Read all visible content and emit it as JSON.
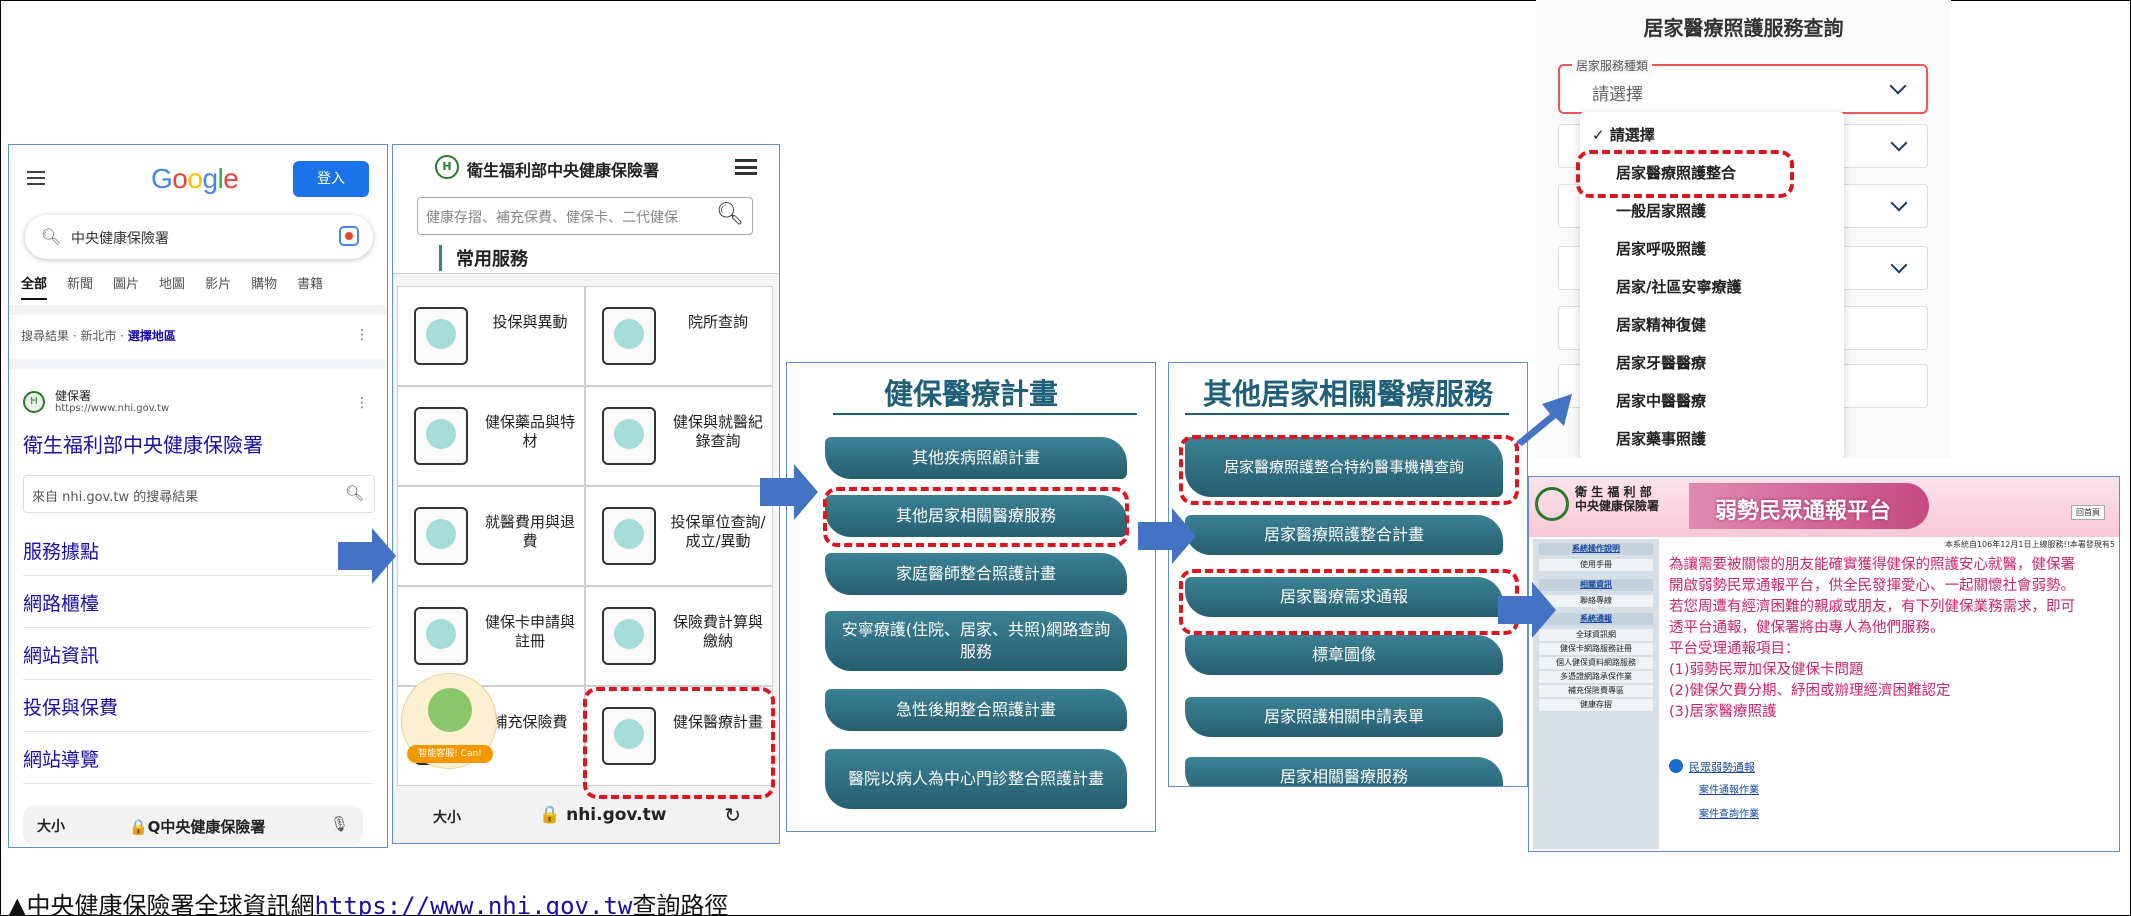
{
  "google": {
    "logo": [
      "G",
      "o",
      "o",
      "g",
      "l",
      "e"
    ],
    "login": "登入",
    "query": "中央健康保險署",
    "tabs": [
      "全部",
      "新聞",
      "圖片",
      "地圖",
      "影片",
      "購物",
      "書籍"
    ],
    "location_prefix": "搜尋結果 · 新北市 · ",
    "location_link": "選擇地區",
    "result_site_name": "健保署",
    "result_url": "https://www.nhi.gov.tw",
    "result_title": "衛生福利部中央健康保險署",
    "site_search_placeholder": "來自 nhi.gov.tw 的搜尋結果",
    "sitelinks": [
      "服務據點",
      "網路櫃檯",
      "網站資訊",
      "投保與保費",
      "網站導覽"
    ],
    "bottom_size": "大小",
    "bottom_url": "🔒Q中央健康保險署"
  },
  "nhi_mobile": {
    "logo_glyph": "H",
    "org_name": "衛生福利部中央健康保險署",
    "search_placeholder": "健康存摺、補充保費、健保卡、二代健保",
    "section_title": "常用服務",
    "services": [
      "投保與異動",
      "院所查詢",
      "健保藥品與特材",
      "健保與就醫紀錄查詢",
      "就醫費用與退費",
      "投保單位查詢/成立/異動",
      "健保卡申請與註冊",
      "保險費計算與繳納",
      "補充保險費",
      "健保醫療計畫"
    ],
    "mascot_badge": "智能客服! Can!",
    "bottom_size": "大小",
    "bottom_url": "🔒 nhi.gov.tw",
    "reload": "↻"
  },
  "plan_panel": {
    "title": "健保醫療計畫",
    "items": [
      "其他疾病照顧計畫",
      "其他居家相關醫療服務",
      "家庭醫師整合照護計畫",
      "安寧療護(住院、居家、共照)網路查詢服務",
      "急性後期整合照護計畫",
      "醫院以病人為中心門診整合照護計畫"
    ]
  },
  "home_panel": {
    "title": "其他居家相關醫療服務",
    "items": [
      "居家醫療照護整合特約醫事機構查詢",
      "居家醫療照護整合計畫",
      "居家醫療需求通報",
      "標章圖像",
      "居家照護相關申請表單",
      "居家相關醫療服務"
    ]
  },
  "query_panel": {
    "title": "居家醫療照護服務查詢",
    "field_label": "居家服務種類",
    "field_value": "請選擇",
    "options": [
      "請選擇",
      "居家醫療照護整合",
      "一般居家照護",
      "居家呼吸照護",
      "居家/社區安寧療護",
      "居家精神復健",
      "居家牙醫醫療",
      "居家中醫醫療",
      "居家藥事照護"
    ]
  },
  "report_panel": {
    "org_line1": "衛 生 福 利 部",
    "org_line2": "中央健康保險署",
    "banner": "弱勢民眾通報平台",
    "home_btn": "回首頁",
    "notice": "本系統自106年12月1日上線服務!!本署發現有5",
    "side_items": [
      "系統操作說明",
      "使用手冊",
      "相關資訊",
      "聯絡專線",
      "系統通報",
      "全球資訊網",
      "健保卡網路服務註冊",
      "個人健保資料網路服務",
      "多憑證網路承保作業",
      "補充保險費專區",
      "健康存摺"
    ],
    "body_lines": [
      "為讓需要被關懷的朋友能確實獲得健保的照護安心就醫，健保署",
      "開啟弱勢民眾通報平台，供全民發揮愛心、一起關懷社會弱勢。",
      "若您周遭有經濟困難的親戚或朋友，有下列健保業務需求，即可",
      "透平台通報，健保署將由專人為他們服務。",
      "平台受理通報項目：",
      "(1)弱勢民眾加保及健保卡問題",
      "(2)健保欠費分期、紓困或辦理經濟困難認定",
      "(3)居家醫療照護"
    ],
    "section_link": "民眾弱勢通報",
    "sub_links": [
      "案件通報作業",
      "案件查詢作業"
    ]
  },
  "caption": {
    "prefix": "▲中央健康保險署全球資訊網",
    "url": "https://www.nhi.gov.tw",
    "suffix": "查詢路徑"
  },
  "colors": {
    "accent_red": "#e0141c",
    "arrow_blue": "#4472c4",
    "teal": "#1f5f78",
    "pink": "#d0246c"
  }
}
